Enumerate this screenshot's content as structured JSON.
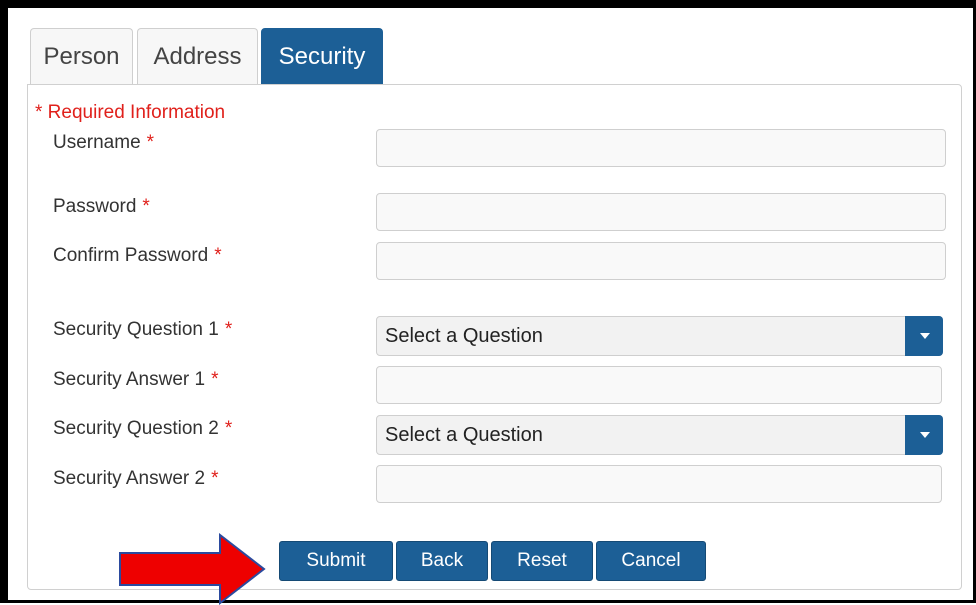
{
  "tabs": [
    "Person",
    "Address",
    "Security"
  ],
  "required_note": "* Required Information",
  "required_marker": "*",
  "fields": {
    "username": {
      "label": "Username",
      "value": ""
    },
    "password": {
      "label": "Password",
      "value": ""
    },
    "confirm_password": {
      "label": "Confirm Password",
      "value": ""
    },
    "security_question_1": {
      "label": "Security Question 1",
      "selected": "Select a Question"
    },
    "security_answer_1": {
      "label": "Security Answer 1",
      "value": ""
    },
    "security_question_2": {
      "label": "Security Question 2",
      "selected": "Select a Question"
    },
    "security_answer_2": {
      "label": "Security Answer 2",
      "value": ""
    }
  },
  "buttons": {
    "submit": "Submit",
    "back": "Back",
    "reset": "Reset",
    "cancel": "Cancel"
  },
  "colors": {
    "primary": "#1c5f96",
    "required": "#e0201b",
    "arrow": "#ee0000"
  }
}
